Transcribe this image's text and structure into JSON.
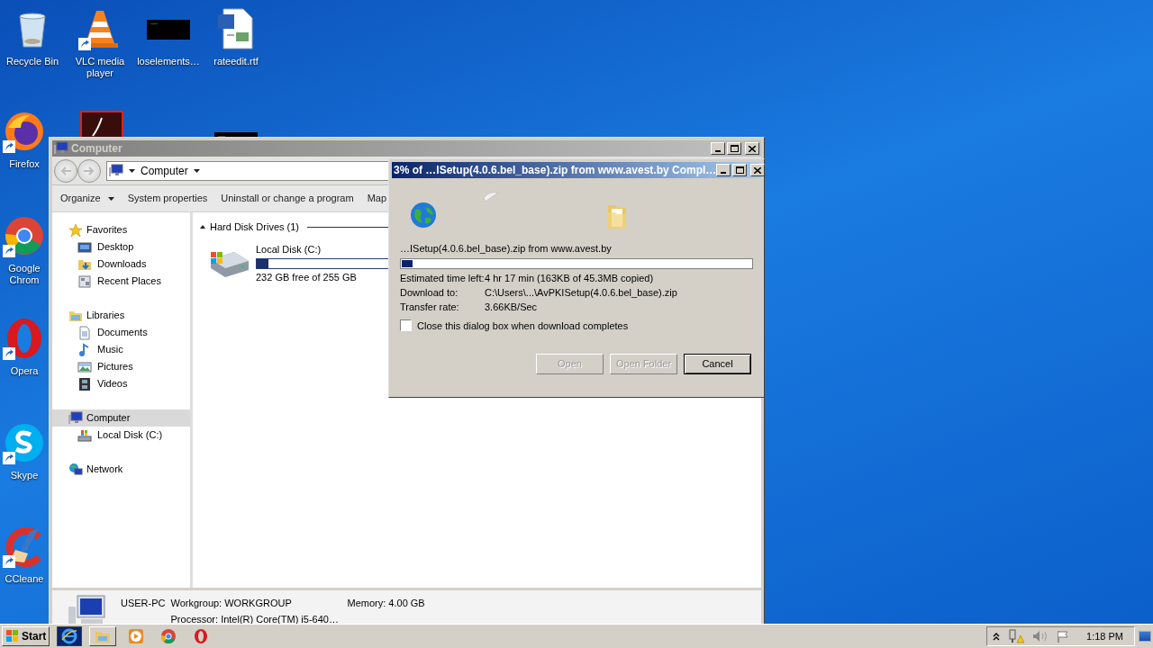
{
  "desktop_icons": [
    {
      "kind": "recycle",
      "label": "Recycle Bin",
      "shortcut": false
    },
    {
      "kind": "vlc",
      "label": "VLC media player",
      "shortcut": true
    },
    {
      "kind": "console",
      "label": "loselements…",
      "shortcut": false
    },
    {
      "kind": "rtf",
      "label": "rateedit.rtf",
      "shortcut": false
    },
    {
      "kind": "firefox",
      "label": "Firefox",
      "shortcut": true
    },
    {
      "kind": "pdf"
    },
    {
      "kind": "console"
    },
    {
      "kind": "chrome",
      "label": "Google Chrom",
      "shortcut": true
    },
    {
      "kind": "opera",
      "label": "Opera",
      "shortcut": true
    },
    {
      "kind": "skype",
      "label": "Skype",
      "shortcut": true
    },
    {
      "kind": "ccleaner",
      "label": "CCleane",
      "shortcut": true
    }
  ],
  "explorer": {
    "title": "Computer",
    "address": "Computer",
    "toolbar": [
      {
        "label": "Organize",
        "dropdown": true
      },
      {
        "label": "System properties",
        "dropdown": false
      },
      {
        "label": "Uninstall or change a program",
        "dropdown": false
      },
      {
        "label": "Map",
        "dropdown": false
      }
    ],
    "nav_groups": [
      {
        "kind": "star",
        "label": "Favorites",
        "selected": false,
        "children": [
          {
            "kind": "desktop",
            "label": "Desktop",
            "selected": false
          },
          {
            "kind": "downloads",
            "label": "Downloads",
            "selected": false
          },
          {
            "kind": "recent",
            "label": "Recent Places",
            "selected": false
          }
        ]
      },
      {
        "kind": "libraries",
        "label": "Libraries",
        "selected": false,
        "children": [
          {
            "kind": "documents",
            "label": "Documents",
            "selected": false
          },
          {
            "kind": "music",
            "label": "Music",
            "selected": false
          },
          {
            "kind": "pictures",
            "label": "Pictures",
            "selected": false
          },
          {
            "kind": "videos",
            "label": "Videos",
            "selected": false
          }
        ]
      },
      {
        "kind": "computer",
        "label": "Computer",
        "selected": true,
        "children": [
          {
            "kind": "disk",
            "label": "Local Disk (C:)",
            "selected": false
          }
        ]
      },
      {
        "kind": "network",
        "label": "Network",
        "selected": false
      }
    ],
    "section": "Hard Disk Drives (1)",
    "drives": [
      {
        "name": "Local Disk (C:)",
        "level": 0.09,
        "free": "232 GB free of 255 GB"
      }
    ],
    "details": {
      "name": "USER-PC",
      "workgroup": "Workgroup: WORKGROUP",
      "memory": "Memory: 4.00 GB",
      "processor": "Processor: Intel(R) Core(TM) i5-640…"
    }
  },
  "download_dialog": {
    "title": "3% of …ISetup(4.0.6.bel_base).zip from www.avest.by Compl…",
    "file_line": "…ISetup(4.0.6.bel_base).zip from www.avest.by",
    "level": 0.03,
    "rows": [
      {
        "label": "Estimated time left:",
        "value": "4 hr 17 min (163KB of 45.3MB copied)"
      },
      {
        "label": "Download to:",
        "value": "C:\\Users\\...\\AvPKISetup(4.0.6.bel_base).zip"
      },
      {
        "label": "Transfer rate:",
        "value": "3.66KB/Sec"
      }
    ],
    "close_when_done": {
      "label": "Close this dialog box when download completes",
      "checked": false
    },
    "buttons": [
      {
        "label": "Open",
        "disabled": true,
        "default": false
      },
      {
        "label": "Open Folder",
        "disabled": true,
        "default": false
      },
      {
        "label": "Cancel",
        "disabled": false,
        "default": true
      }
    ]
  },
  "taskbar": {
    "start": "Start",
    "apps": [
      {
        "kind": "ie",
        "active": true,
        "button": false
      },
      {
        "kind": "explorer",
        "active": false,
        "button": true
      },
      {
        "kind": "player",
        "active": false,
        "button": false
      },
      {
        "kind": "chrome",
        "active": false,
        "button": false
      },
      {
        "kind": "opera",
        "active": false,
        "button": false
      }
    ],
    "clock": "1:18 PM"
  }
}
